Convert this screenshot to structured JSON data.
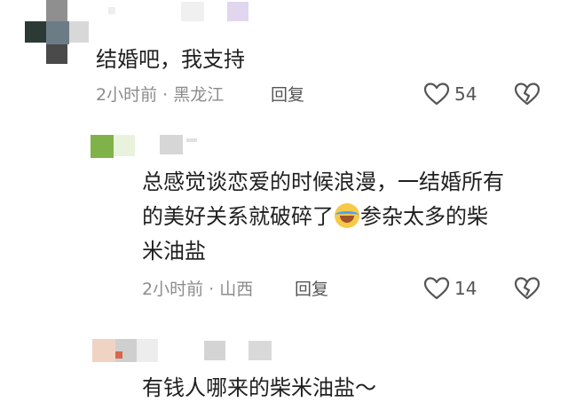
{
  "comments": [
    {
      "text": "结婚吧，我支持",
      "time_location": "2小时前 · 黑龙江",
      "reply_label": "回复",
      "likes": "54"
    },
    {
      "text_line1": "总感觉谈恋爱的时候浪漫，一结婚所有",
      "text_line2a": "的美好关系就破碎了",
      "emoji": "crying-laughing-emoji",
      "text_line2b": "参杂太多的柴",
      "text_line3": "米油盐",
      "time_location": "2小时前 · 山西",
      "reply_label": "回复",
      "likes": "14"
    },
    {
      "text": "有钱人哪来的柴米油盐～"
    }
  ],
  "colors": {
    "text": "#1f1f1f",
    "meta": "#8c8c8c",
    "icon": "#555555"
  }
}
